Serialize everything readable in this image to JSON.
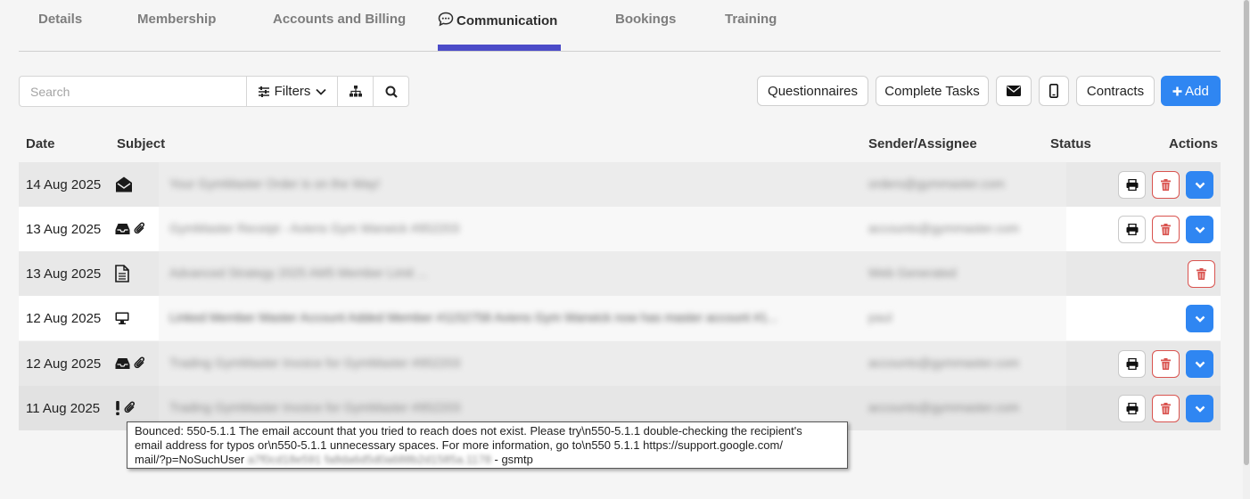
{
  "tabs": [
    "Details",
    "Membership",
    "Accounts and Billing",
    "Communication",
    "Bookings",
    "Training"
  ],
  "active_tab": "Communication",
  "toolbar": {
    "search_placeholder": "Search",
    "filters_label": "Filters",
    "questionnaires_label": "Questionnaires",
    "complete_tasks_label": "Complete Tasks",
    "contracts_label": "Contracts",
    "add_label": "Add"
  },
  "table": {
    "headers": {
      "date": "Date",
      "subject": "Subject",
      "sender": "Sender/Assignee",
      "status": "Status",
      "actions": "Actions"
    },
    "rows": [
      {
        "date": "14 Aug 2025",
        "icons": [
          "envelope-open-icon"
        ],
        "subject": "Your GymMaster Order is on the Way!",
        "sender": "orders@gymmaster.com",
        "actions": [
          "print",
          "delete",
          "more"
        ]
      },
      {
        "date": "13 Aug 2025",
        "icons": [
          "inbox-icon",
          "paperclip-icon"
        ],
        "subject": "GymMaster Receipt - Aviens Gym Warwick #952203",
        "sender": "accounts@gymmaster.com",
        "actions": [
          "print",
          "delete",
          "more"
        ]
      },
      {
        "date": "13 Aug 2025",
        "icons": [
          "document-icon"
        ],
        "subject": "Advanced Strategy 2025 AM5 Member Limit ...",
        "sender": "Web Generated",
        "actions": [
          "delete"
        ]
      },
      {
        "date": "12 Aug 2025",
        "icons": [
          "monitor-icon"
        ],
        "subject": "Linked Member Master Account Added  Member #1152758 Aviens Gym Warwick now has master account #1...",
        "sender": "paul",
        "actions": [
          "more"
        ]
      },
      {
        "date": "12 Aug 2025",
        "icons": [
          "inbox-icon",
          "paperclip-icon"
        ],
        "subject": "Trading GymMaster Invoice for GymMaster #952203",
        "sender": "accounts@gymmaster.com",
        "actions": [
          "print",
          "delete",
          "more"
        ]
      },
      {
        "date": "11 Aug 2025",
        "icons": [
          "exclamation-icon",
          "paperclip-icon"
        ],
        "subject": "Trading GymMaster Invoice for GymMaster #952203",
        "sender": "accounts@gymmaster.com",
        "actions": [
          "print",
          "delete",
          "more"
        ]
      }
    ]
  },
  "tooltip": {
    "line1": "Bounced: 550-5.1.1 The email account that you tried to reach does not exist. Please try\\n550-5.1.1 double-checking the recipient's",
    "line2": "email address for typos or\\n550-5.1.1 unnecessary spaces. For more information, go to\\n550 5.1.1  https://support.google.com/",
    "line3_prefix": "mail/?p=NoSuchUser",
    "line3_blurred": "a7f0cd18e591 fa8da6d5d0a688b2d1585a.1178",
    "line3_suffix": "- gsmtp"
  },
  "colors": {
    "primary": "#2f86f2",
    "tab_underline": "#4b4bc8",
    "danger": "#d9534f"
  }
}
